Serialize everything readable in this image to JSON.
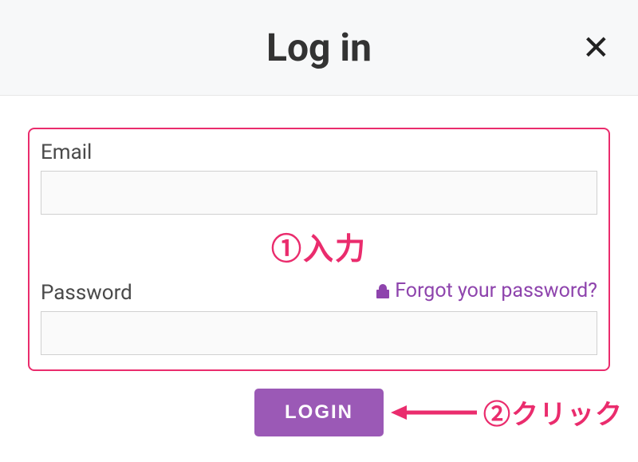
{
  "header": {
    "title": "Log in"
  },
  "form": {
    "email_label": "Email",
    "email_value": "",
    "password_label": "Password",
    "password_value": "",
    "forgot_link_text": "Forgot your password?",
    "login_button_label": "LOGIN"
  },
  "annotations": {
    "step1": "①入力",
    "step2": "②クリック"
  },
  "colors": {
    "accent_purple": "#9b59b6",
    "link_purple": "#8e44ad",
    "highlight_pink": "#ea2c6d"
  }
}
